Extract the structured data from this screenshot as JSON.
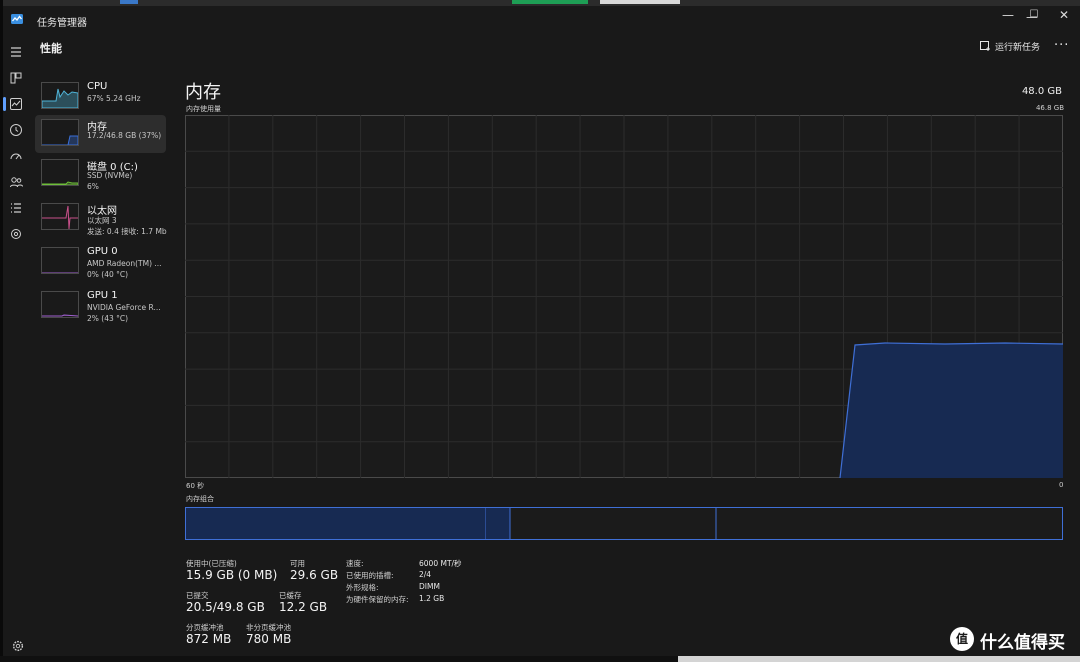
{
  "app": {
    "title": "任务管理器"
  },
  "window_controls": {
    "minimize": "—",
    "maximize": "☐",
    "close": "✕"
  },
  "header": {
    "section": "性能",
    "run_task": "运行新任务",
    "more": "···"
  },
  "resources": [
    {
      "name": "CPU",
      "l2": "67% 5.24 GHz",
      "l3": "",
      "color": "#4fb4d8"
    },
    {
      "name": "内存",
      "l2": "17.2/46.8 GB (37%)",
      "l3": "",
      "color": "#3a6fd8"
    },
    {
      "name": "磁盘 0 (C:)",
      "l2": "SSD (NVMe)",
      "l3": "6%",
      "color": "#6fbf3a"
    },
    {
      "name": "以太网",
      "l2": "以太网 3",
      "l3": "发送: 0.4 接收: 1.7 Mb",
      "color": "#c8508a"
    },
    {
      "name": "GPU 0",
      "l2": "AMD Radeon(TM) ...",
      "l3": "0% (40 °C)",
      "color": "#a060d0"
    },
    {
      "name": "GPU 1",
      "l2": "NVIDIA GeForce R...",
      "l3": "2% (43 °C)",
      "color": "#a060d0"
    }
  ],
  "main": {
    "title": "内存",
    "total": "48.0 GB",
    "usage_label": "内存使用量",
    "usage_max": "46.8 GB",
    "axis_left": "60 秒",
    "axis_right": "0",
    "composition_label": "内存组合",
    "in_use_fraction": 0.37
  },
  "stats": {
    "in_use_label": "使用中(已压缩)",
    "in_use_value": "15.9 GB (0 MB)",
    "available_label": "可用",
    "available_value": "29.6 GB",
    "committed_label": "已提交",
    "committed_value": "20.5/49.8 GB",
    "cached_label": "已缓存",
    "cached_value": "12.2 GB",
    "paged_label": "分页缓冲池",
    "paged_value": "872 MB",
    "nonpaged_label": "非分页缓冲池",
    "nonpaged_value": "780 MB"
  },
  "details": [
    {
      "key": "速度:",
      "value": "6000 MT/秒"
    },
    {
      "key": "已使用的插槽:",
      "value": "2/4"
    },
    {
      "key": "外形规格:",
      "value": "DIMM"
    },
    {
      "key": "为硬件保留的内存:",
      "value": "1.2 GB"
    }
  ],
  "watermark": {
    "logo": "值",
    "text": "什么值得买"
  },
  "colors": {
    "accent": "#3a6fd8",
    "graph_fill": "#172a52",
    "graph_line": "#3f6fd6"
  }
}
